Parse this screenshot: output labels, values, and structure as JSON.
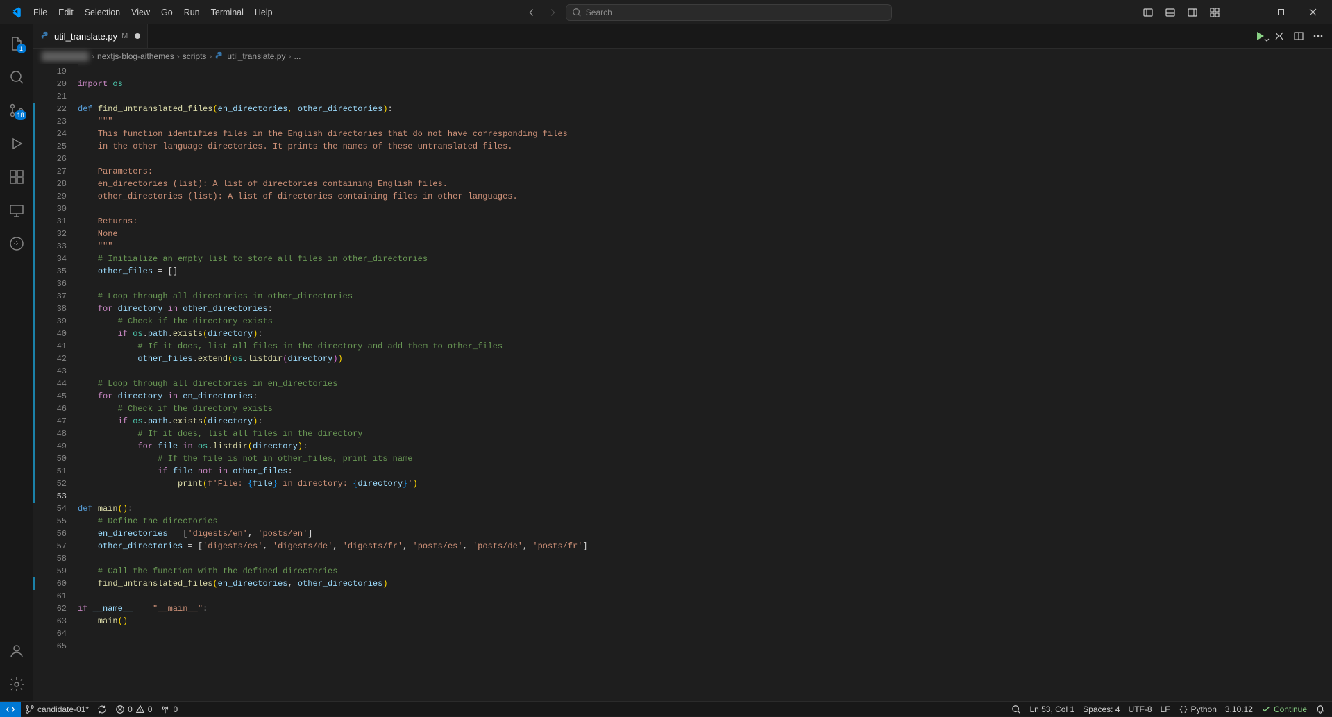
{
  "menu": [
    "File",
    "Edit",
    "Selection",
    "View",
    "Go",
    "Run",
    "Terminal",
    "Help"
  ],
  "search_placeholder": "Search",
  "tab": {
    "name": "util_translate.py",
    "modified_badge": "M"
  },
  "breadcrumb": {
    "blur1": "████████",
    "p1": "nextjs-blog-aithemes",
    "p2": "scripts",
    "p3": "util_translate.py",
    "p4": "..."
  },
  "activity_badges": {
    "explorer": "1",
    "scm": "18"
  },
  "line_start": 19,
  "line_end": 65,
  "code_lines": [
    {
      "t": "plain",
      "text": ""
    },
    {
      "t": "import",
      "kw": "import",
      "mod": "os"
    },
    {
      "t": "blank"
    },
    {
      "t": "def",
      "kw": "def",
      "name": "find_untranslated_files",
      "params": "(en_directories, other_directories)"
    },
    {
      "t": "doc",
      "text": "    \"\"\""
    },
    {
      "t": "doc",
      "text": "    This function identifies files in the English directories that do not have corresponding files"
    },
    {
      "t": "doc",
      "text": "    in the other language directories. It prints the names of these untranslated files."
    },
    {
      "t": "blank"
    },
    {
      "t": "doc",
      "text": "    Parameters:"
    },
    {
      "t": "doc",
      "text": "    en_directories (list): A list of directories containing English files."
    },
    {
      "t": "doc",
      "text": "    other_directories (list): A list of directories containing files in other languages."
    },
    {
      "t": "blank"
    },
    {
      "t": "doc",
      "text": "    Returns:"
    },
    {
      "t": "doc",
      "text": "    None"
    },
    {
      "t": "doc",
      "text": "    \"\"\""
    },
    {
      "t": "com",
      "text": "    # Initialize an empty list to store all files in other_directories"
    },
    {
      "t": "code",
      "html": "    <span class='tok-var'>other_files</span> = []"
    },
    {
      "t": "blank"
    },
    {
      "t": "com",
      "text": "    # Loop through all directories in other_directories"
    },
    {
      "t": "code",
      "html": "    <span class='tok-kw'>for</span> <span class='tok-var'>directory</span> <span class='tok-kw'>in</span> <span class='tok-var'>other_directories</span>:"
    },
    {
      "t": "com",
      "text": "        # Check if the directory exists"
    },
    {
      "t": "code",
      "html": "        <span class='tok-kw'>if</span> <span class='tok-mod'>os</span>.<span class='tok-var'>path</span>.<span class='tok-fn'>exists</span><span class='tok-pn'>(</span><span class='tok-var'>directory</span><span class='tok-pn'>)</span>:"
    },
    {
      "t": "com",
      "text": "            # If it does, list all files in the directory and add them to other_files"
    },
    {
      "t": "code",
      "html": "            <span class='tok-var'>other_files</span>.<span class='tok-fn'>extend</span><span class='tok-pn'>(</span><span class='tok-mod'>os</span>.<span class='tok-fn'>listdir</span><span class='tok-pn2'>(</span><span class='tok-var'>directory</span><span class='tok-pn2'>)</span><span class='tok-pn'>)</span>"
    },
    {
      "t": "blank"
    },
    {
      "t": "com",
      "text": "    # Loop through all directories in en_directories"
    },
    {
      "t": "code",
      "html": "    <span class='tok-kw'>for</span> <span class='tok-var'>directory</span> <span class='tok-kw'>in</span> <span class='tok-var'>en_directories</span>:"
    },
    {
      "t": "com",
      "text": "        # Check if the directory exists"
    },
    {
      "t": "code",
      "html": "        <span class='tok-kw'>if</span> <span class='tok-mod'>os</span>.<span class='tok-var'>path</span>.<span class='tok-fn'>exists</span><span class='tok-pn'>(</span><span class='tok-var'>directory</span><span class='tok-pn'>)</span>:"
    },
    {
      "t": "com",
      "text": "            # If it does, list all files in the directory"
    },
    {
      "t": "code",
      "html": "            <span class='tok-kw'>for</span> <span class='tok-var'>file</span> <span class='tok-kw'>in</span> <span class='tok-mod'>os</span>.<span class='tok-fn'>listdir</span><span class='tok-pn'>(</span><span class='tok-var'>directory</span><span class='tok-pn'>)</span>:"
    },
    {
      "t": "com",
      "text": "                # If the file is not in other_files, print its name"
    },
    {
      "t": "code",
      "html": "                <span class='tok-kw'>if</span> <span class='tok-var'>file</span> <span class='tok-kw'>not</span> <span class='tok-kw'>in</span> <span class='tok-var'>other_files</span>:"
    },
    {
      "t": "code",
      "html": "                    <span class='tok-fn'>print</span><span class='tok-pn'>(</span><span class='tok-str'>f'File: </span><span class='tok-pn3'>{</span><span class='tok-var'>file</span><span class='tok-pn3'>}</span><span class='tok-str'> in directory: </span><span class='tok-pn3'>{</span><span class='tok-var'>directory</span><span class='tok-pn3'>}</span><span class='tok-str'>'</span><span class='tok-pn'>)</span>"
    },
    {
      "t": "blank",
      "current": true
    },
    {
      "t": "def",
      "kw": "def",
      "name": "main",
      "params": "()"
    },
    {
      "t": "com",
      "text": "    # Define the directories"
    },
    {
      "t": "code",
      "html": "    <span class='tok-var'>en_directories</span> = [<span class='tok-str'>'digests/en'</span>, <span class='tok-str'>'posts/en'</span>]"
    },
    {
      "t": "code",
      "html": "    <span class='tok-var'>other_directories</span> = [<span class='tok-str'>'digests/es'</span>, <span class='tok-str'>'digests/de'</span>, <span class='tok-str'>'digests/fr'</span>, <span class='tok-str'>'posts/es'</span>, <span class='tok-str'>'posts/de'</span>, <span class='tok-str'>'posts/fr'</span>]"
    },
    {
      "t": "blank"
    },
    {
      "t": "com",
      "text": "    # Call the function with the defined directories"
    },
    {
      "t": "code",
      "html": "    <span class='tok-fn'>find_untranslated_files</span><span class='tok-pn'>(</span><span class='tok-var'>en_directories</span>, <span class='tok-var'>other_directories</span><span class='tok-pn'>)</span>"
    },
    {
      "t": "blank"
    },
    {
      "t": "code",
      "html": "<span class='tok-kw'>if</span> <span class='tok-var'>__name__</span> == <span class='tok-str'>\"__main__\"</span>:"
    },
    {
      "t": "code",
      "html": "    <span class='tok-fn'>main</span><span class='tok-pn'>()</span>"
    },
    {
      "t": "blank"
    },
    {
      "t": "blank"
    }
  ],
  "git_modified_ranges": [
    [
      22,
      53
    ],
    [
      60,
      60
    ]
  ],
  "status": {
    "branch": "candidate-01*",
    "sync": "",
    "errors": "0",
    "warnings": "0",
    "ports": "0",
    "lncol": "Ln 53, Col 1",
    "spaces": "Spaces: 4",
    "encoding": "UTF-8",
    "eol": "LF",
    "lang": "Python",
    "pyver": "3.10.12",
    "continue": "Continue"
  }
}
